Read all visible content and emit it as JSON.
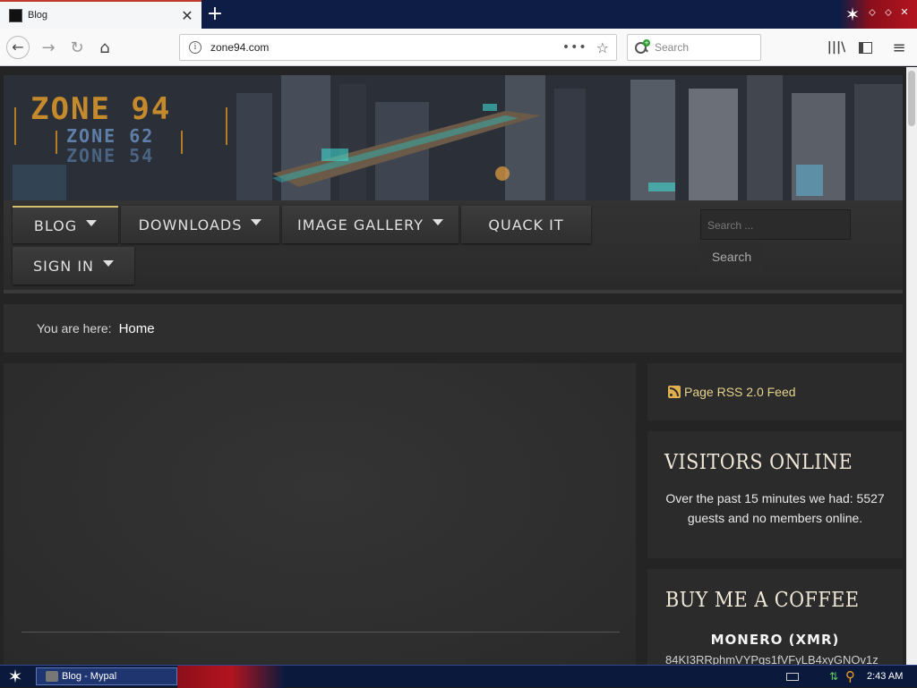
{
  "browser": {
    "tab_title": "Blog",
    "url": "zone94.com",
    "search_placeholder": "Search"
  },
  "site": {
    "logo_main": "ZONE 94",
    "logo_sub1": "ZONE 62",
    "logo_sub2": "ZONE 54",
    "menu": [
      {
        "label": "BLOG",
        "has_dropdown": true,
        "active": true
      },
      {
        "label": "DOWNLOADS",
        "has_dropdown": true,
        "active": false
      },
      {
        "label": "IMAGE GALLERY",
        "has_dropdown": true,
        "active": false
      },
      {
        "label": "QUACK IT",
        "has_dropdown": false,
        "active": false
      },
      {
        "label": "SIGN IN",
        "has_dropdown": true,
        "active": false
      }
    ],
    "search_placeholder": "Search ...",
    "search_button": "Search",
    "breadcrumb": {
      "label": "You are here:",
      "home": "Home"
    },
    "rss_link": "Page RSS 2.0 Feed",
    "visitors": {
      "title": "VISITORS ONLINE",
      "text": "Over the past 15 minutes we had: 5527 guests and no members online."
    },
    "coffee": {
      "title": "BUY ME A COFFEE",
      "subtitle": "MONERO (XMR)",
      "address": "84KI3RRphmVYPqs1fVFyLB4xyGNOv1z"
    },
    "colors": {
      "accent": "#e6d28c",
      "background": "#242424"
    }
  },
  "taskbar": {
    "window_label": "Blog - Mypal",
    "time": "2:43 AM"
  }
}
